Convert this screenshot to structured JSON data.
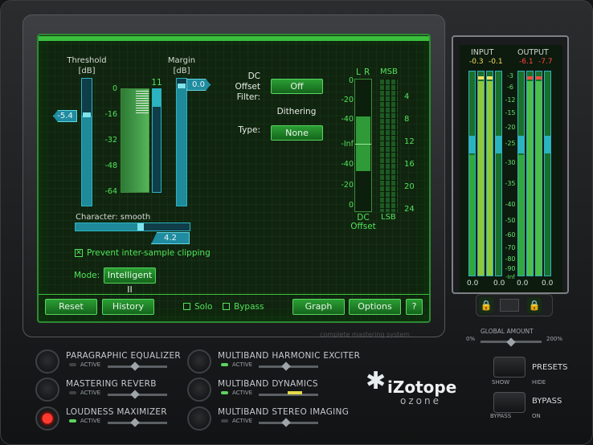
{
  "threshold": {
    "label": "Threshold",
    "unit": "[dB]",
    "value": "-5.4"
  },
  "margin": {
    "label": "Margin",
    "unit": "[dB]",
    "value": "0.0"
  },
  "gain_reduction_scale": [
    "0",
    "-16",
    "-32",
    "-48",
    "-64"
  ],
  "gr_value": "11",
  "dc_filter": {
    "label1": "DC",
    "label2": "Offset",
    "label3": "Filter:",
    "value": "Off"
  },
  "dithering": {
    "label": "Dithering",
    "type_label": "Type:",
    "value": "None"
  },
  "dither_meter": {
    "left_label": "L",
    "right_label": "R",
    "msb": "MSB",
    "lsb": "LSB",
    "scale": [
      "0",
      "-20",
      "-40",
      "-Inf",
      "-40",
      "-20",
      "0"
    ],
    "bits": [
      "4",
      "8",
      "12",
      "16",
      "20",
      "24"
    ],
    "dc": "DC",
    "offset": "Offset"
  },
  "character": {
    "label": "Character: smooth",
    "value": "4.2",
    "level": 0.55
  },
  "prevent_clipping": {
    "label": "Prevent inter-sample clipping",
    "checked": true
  },
  "mode": {
    "label": "Mode:",
    "value": "Intelligent II"
  },
  "bottom_buttons": {
    "reset": "Reset",
    "history": "History",
    "solo": "Solo",
    "bypass": "Bypass",
    "graph": "Graph",
    "options": "Options",
    "help": "?"
  },
  "tagline": "complete mastering system",
  "io_meter": {
    "input_label": "INPUT",
    "output_label": "OUTPUT",
    "input_peak_l": "-0.3",
    "input_peak_r": "-0.1",
    "output_peak_l": "-6.1",
    "output_peak_r": "-7.7",
    "scale": [
      "-3",
      "-6",
      "-12",
      "-15",
      "-20",
      "-25",
      "-30",
      "-35",
      "-40",
      "-50",
      "-60",
      "-70",
      "-80",
      "-90",
      "-Inf"
    ],
    "readout_in_l": "0.0",
    "readout_in_r": "0.0",
    "readout_out_l": "0.0",
    "readout_out_r": "0.0",
    "input_level": 0.95,
    "output_level": 0.93
  },
  "global_amount": {
    "label": "GLOBAL AMOUNT",
    "min": "0%",
    "max": "200%",
    "level": 0.5
  },
  "modules": [
    {
      "name": "PARAGRAPHIC EQUALIZER",
      "active_label": "ACTIVE",
      "active": false
    },
    {
      "name": "MASTERING REVERB",
      "active_label": "ACTIVE",
      "active": false
    },
    {
      "name": "LOUDNESS MAXIMIZER",
      "active_label": "ACTIVE",
      "active": true
    },
    {
      "name": "MULTIBAND HARMONIC EXCITER",
      "active_label": "ACTIVE",
      "active": true
    },
    {
      "name": "MULTIBAND DYNAMICS",
      "active_label": "ACTIVE",
      "active": true
    },
    {
      "name": "MULTIBAND STEREO IMAGING",
      "active_label": "ACTIVE",
      "active": false
    }
  ],
  "brand": {
    "name": "iZotope",
    "product": "ozone"
  },
  "presets": {
    "label": "PRESETS",
    "show": "SHOW",
    "hide": "HIDE"
  },
  "bypass": {
    "label": "BYPASS",
    "bypass": "BYPASS",
    "on": "ON"
  },
  "colors": {
    "screen_green": "#52e35a",
    "accent_cyan": "#1f8ca1",
    "power_red": "#e0201c"
  }
}
